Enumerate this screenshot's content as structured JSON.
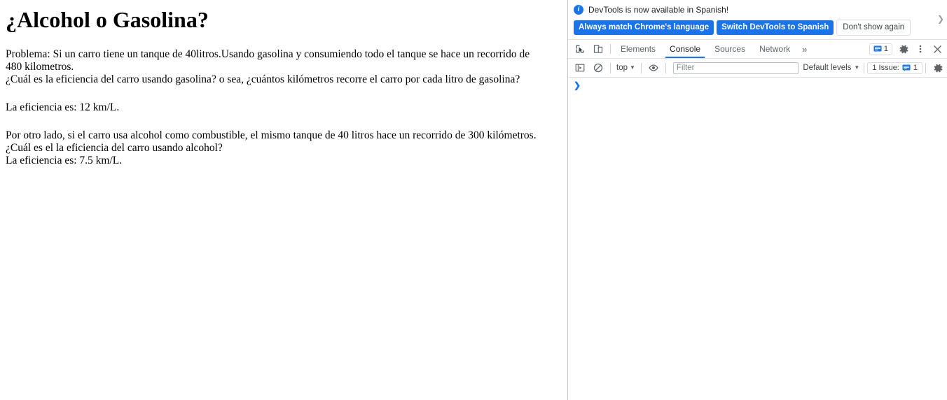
{
  "page": {
    "title": "¿Alcohol o Gasolina?",
    "paragraph1_line1": "Problema: Si un carro tiene un tanque de 40litros.Usando gasolina y consumiendo todo el tanque se hace un recorrido de",
    "paragraph1_line2": "480 kilometros.",
    "paragraph1_line3": "¿Cuál es la eficiencia del carro usando gasolina? o sea, ¿cuántos kilómetros recorre el carro por cada litro de gasolina?",
    "result1": "La eficiencia es: 12 km/L.",
    "paragraph2_line1": "Por otro lado, si el carro usa alcohol como combustible, el mismo tanque de 40 litros hace un recorrido de 300 kilómetros.",
    "paragraph2_line2": "¿Cuál es el la eficiencia del carro usando alcohol?",
    "result2": "La eficiencia es: 7.5 km/L."
  },
  "devtools": {
    "banner": {
      "icon": "info-icon",
      "message": "DevTools is now available in Spanish!",
      "primary_button_1": "Always match Chrome's language",
      "primary_button_2": "Switch DevTools to Spanish",
      "secondary_button": "Don't show again",
      "chevron": "❯",
      "accent_color": "#1a73e8"
    },
    "tabbar": {
      "inspect_icon": "inspect-element-icon",
      "device_icon": "device-toolbar-icon",
      "tabs": [
        {
          "label": "Elements",
          "active": false
        },
        {
          "label": "Console",
          "active": true
        },
        {
          "label": "Sources",
          "active": false
        },
        {
          "label": "Network",
          "active": false
        }
      ],
      "more_tabs": "»",
      "message_count": "1",
      "settings_icon": "gear-icon",
      "menu_icon": "kebab-menu-icon",
      "close_icon": "close-icon"
    },
    "console_toolbar": {
      "sidebar_icon": "console-sidebar-icon",
      "clear_icon": "clear-console-icon",
      "context": "top",
      "eye_icon": "live-expression-eye-icon",
      "filter_placeholder": "Filter",
      "filter_value": "",
      "levels": "Default levels",
      "issues_label": "1 Issue:",
      "issues_count": "1",
      "settings_icon": "console-settings-gear-icon"
    },
    "console": {
      "prompt": "❯"
    }
  }
}
